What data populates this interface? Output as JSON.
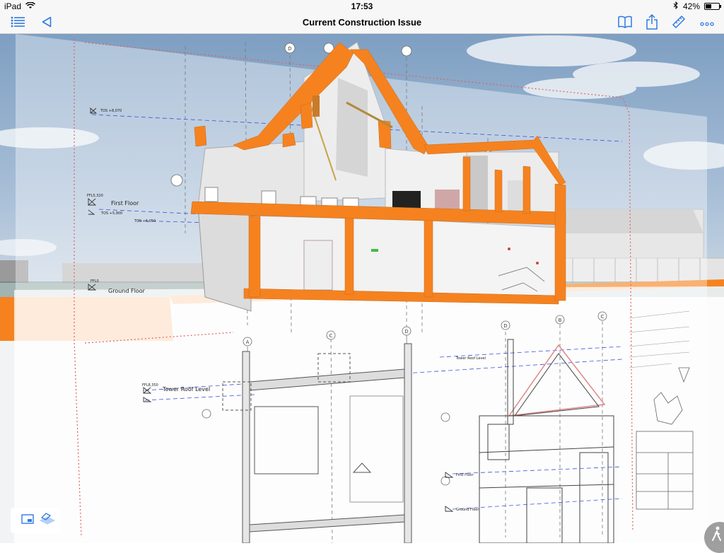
{
  "status": {
    "device": "iPad",
    "time": "17:53",
    "battery": "42%",
    "battery_level": 0.42
  },
  "nav": {
    "title": "Current Construction Issue"
  },
  "colors": {
    "accent": "#2f7ae5",
    "section_fill": "#f5821f",
    "sky": "#8aa9c8",
    "drawing_line": "#555555",
    "revision_cloud": "#e06060"
  },
  "icons": {
    "menu": "list-icon",
    "back": "back-triangle-icon",
    "book": "book-icon",
    "share": "share-icon",
    "measure": "ruler-icon",
    "more": "more-icon",
    "view": "view-panel-icon",
    "layers": "layers-icon",
    "walk": "walk-icon"
  },
  "drawing": {
    "levels": [
      {
        "code": "TOS +8,070",
        "name": ""
      },
      {
        "code": "FFL5,320",
        "name": "First Floor"
      },
      {
        "code": "TOS +5,900",
        "name": ""
      },
      {
        "code": "TOS +5,050",
        "name": ""
      },
      {
        "code": "FFL0",
        "name": "Ground Floor"
      },
      {
        "code": "FFL8,350",
        "name": "Tower Roof Level"
      },
      {
        "code": "",
        "name": "Tower Roof Level"
      },
      {
        "code": "",
        "name": "First Floor"
      },
      {
        "code": "",
        "name": "Ground Floor"
      }
    ],
    "grid_labels": [
      "A",
      "C",
      "D",
      "D",
      "B",
      "C",
      "D"
    ]
  }
}
